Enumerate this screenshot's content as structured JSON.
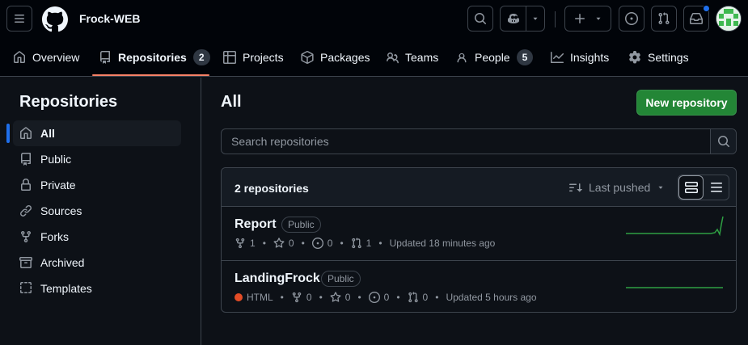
{
  "org": {
    "name": "Frock-WEB"
  },
  "nav_tabs": [
    {
      "label": "Overview"
    },
    {
      "label": "Repositories",
      "count": "2"
    },
    {
      "label": "Projects"
    },
    {
      "label": "Packages"
    },
    {
      "label": "Teams"
    },
    {
      "label": "People",
      "count": "5"
    },
    {
      "label": "Insights"
    },
    {
      "label": "Settings"
    }
  ],
  "sidebar": {
    "title": "Repositories",
    "items": [
      {
        "label": "All",
        "icon": "home-icon"
      },
      {
        "label": "Public",
        "icon": "repo-icon"
      },
      {
        "label": "Private",
        "icon": "lock-icon"
      },
      {
        "label": "Sources",
        "icon": "link-icon"
      },
      {
        "label": "Forks",
        "icon": "fork-icon"
      },
      {
        "label": "Archived",
        "icon": "archive-icon"
      },
      {
        "label": "Templates",
        "icon": "template-icon"
      }
    ]
  },
  "main": {
    "title": "All",
    "new_repo_label": "New repository",
    "search_placeholder": "Search repositories",
    "count_label": "2 repositories",
    "sort_label": "Last pushed"
  },
  "repos": [
    {
      "name": "Report",
      "visibility": "Public",
      "forks": "1",
      "stars": "0",
      "issues": "0",
      "prs": "1",
      "updated": "Updated 18 minutes ago"
    },
    {
      "name": "LandingFrock",
      "visibility": "Public",
      "language": "HTML",
      "forks": "0",
      "stars": "0",
      "issues": "0",
      "prs": "0",
      "updated": "Updated 5 hours ago"
    }
  ],
  "colors": {
    "accent_tab": "#f78166",
    "primary_button": "#238636",
    "html_lang": "#e34c26",
    "notification_dot": "#1f6feb"
  }
}
